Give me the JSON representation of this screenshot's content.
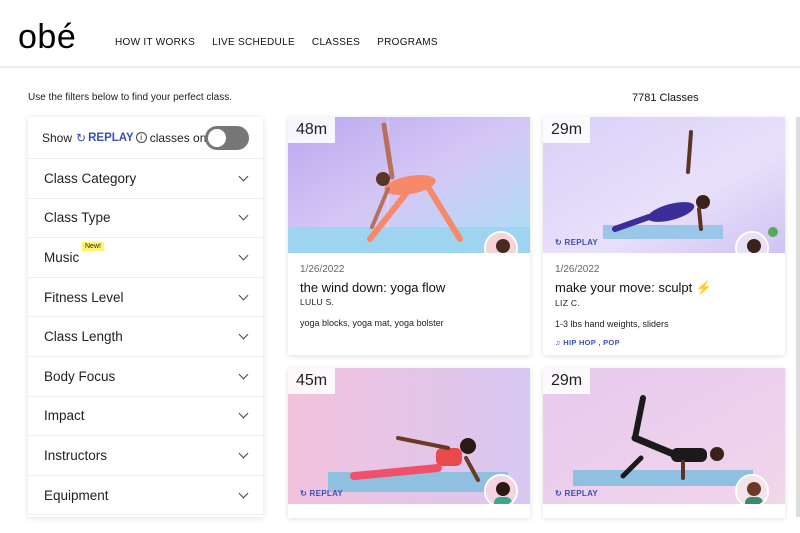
{
  "brand": {
    "logo": "obé"
  },
  "nav": [
    "HOW IT WORKS",
    "LIVE SCHEDULE",
    "CLASSES",
    "PROGRAMS"
  ],
  "hint": "Use the filters below to find your perfect class.",
  "count": "7781 Classes",
  "replay_filter": {
    "prefix": "Show",
    "replay": "REPLAY",
    "suffix": "classes only",
    "enabled": false
  },
  "filters": [
    {
      "label": "Class Category"
    },
    {
      "label": "Class Type"
    },
    {
      "label": "Music",
      "badge": "New!"
    },
    {
      "label": "Fitness Level"
    },
    {
      "label": "Class Length"
    },
    {
      "label": "Body Focus"
    },
    {
      "label": "Impact"
    },
    {
      "label": "Instructors"
    },
    {
      "label": "Equipment"
    }
  ],
  "cards": [
    {
      "duration": "48m",
      "date": "1/26/2022",
      "title": "the wind down: yoga flow",
      "instructor": "LULU S.",
      "equipment": "yoga blocks, yoga mat, yoga bolster",
      "music": "",
      "replay": ""
    },
    {
      "duration": "29m",
      "date": "1/26/2022",
      "title": "make your move: sculpt",
      "instructor": "LIZ C.",
      "equipment": "1-3 lbs hand weights, sliders",
      "music": "♫ HIP HOP , POP",
      "replay": "REPLAY"
    },
    {
      "duration": "45m",
      "replay": "REPLAY"
    },
    {
      "duration": "29m",
      "replay": "REPLAY"
    }
  ],
  "colors": {
    "accent": "#3a4fb5",
    "toggle_off": "#777777"
  }
}
